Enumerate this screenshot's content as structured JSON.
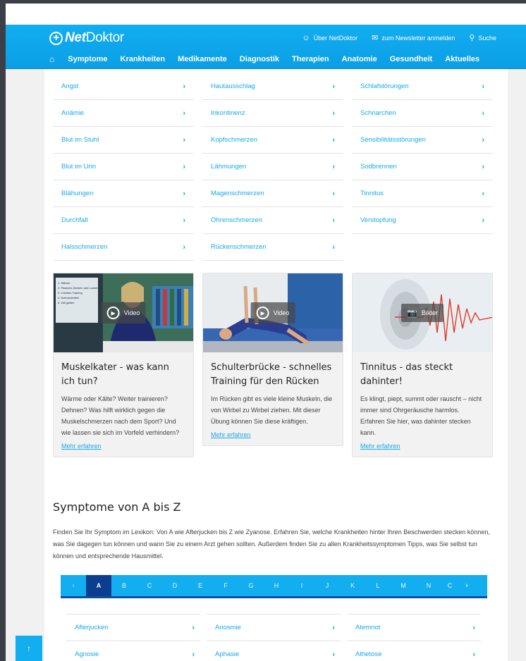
{
  "header": {
    "logo_net": "Net",
    "logo_doktor": "Doktor",
    "top_links": [
      {
        "icon": "person-icon",
        "label": "Über NetDoktor"
      },
      {
        "icon": "mail-icon",
        "label": "zum Newsletter anmelden"
      },
      {
        "icon": "search-icon",
        "label": "Suche"
      }
    ],
    "nav": [
      "Symptome",
      "Krankheiten",
      "Medikamente",
      "Diagnostik",
      "Therapien",
      "Anatomie",
      "Gesundheit",
      "Aktuelles"
    ]
  },
  "symptoms": {
    "col1": [
      "Angst",
      "Anämie",
      "Blut im Stuhl",
      "Blut im Urin",
      "Blähungen",
      "Durchfall",
      "Halsschmerzen"
    ],
    "col2": [
      "Hautausschlag",
      "Inkontinenz",
      "Kopfschmerzen",
      "Lähmungen",
      "Magenschmerzen",
      "Ohrenschmerzen",
      "Rückenschmerzen"
    ],
    "col3": [
      "Schlafstörungen",
      "Schnarchen",
      "Sensibilitätsstörungen",
      "Sodbrennen",
      "Tinnitus",
      "Verstopfung"
    ]
  },
  "cards": [
    {
      "badge": "Video",
      "title": "Muskelkater - was kann ich tun?",
      "text": "Wärme oder Kälte? Weiter trainieren? Dehnen? Was hilft wirklich gegen die Muskelschmerzen nach dem Sport? Und wie lassen sie sich im Vorfeld verhindern?",
      "more": "Mehr erfahren",
      "slide_list": [
        "1. Wärme",
        "2. Passives Dehnen und Lockern",
        "3. Leichtes Training",
        "4. Schmerzmittel",
        "5. Zeit geben"
      ]
    },
    {
      "badge": "Video",
      "title": "Schulterbrücke - schnelles Training für den Rücken",
      "text": "Im Rücken gibt es viele kleine Muskeln, die von Wirbel zu Wirbel ziehen. Mit dieser Übung können Sie diese kräftigen.",
      "more": "Mehr erfahren"
    },
    {
      "badge": "Bilder",
      "title": "Tinnitus - das steckt dahinter!",
      "text": "Es klingt, piept, summt oder rauscht – nicht immer sind Ohrgeräusche harmlos. Erfahren Sie hier, was dahinter stecken kann.",
      "more": "Mehr erfahren"
    }
  ],
  "az": {
    "title": "Symptome von A bis Z",
    "intro": "Finden Sie Ihr Symptom im Lexikon: Von A wie Afterjucken bis Z wie Zyanose. Erfahren Sie, welche Krankheiten hinter Ihren Beschwerden stecken können, was Sie dagegen tun können und wann Sie zu einem Arzt gehen sollten. Außerdem finden Sie zu allen Krankheitssymptomen Tipps, was Sie selbst tun können und entsprechende Hausmittel.",
    "letters": [
      "A",
      "B",
      "C",
      "D",
      "E",
      "F",
      "G",
      "H",
      "I",
      "J",
      "K",
      "L",
      "M",
      "N",
      "C"
    ],
    "active": "A",
    "prev": "‹",
    "next": "›",
    "col1": [
      "Afterjucken",
      "Agnosie"
    ],
    "col2": [
      "Anosmie",
      "Aphasie"
    ],
    "col3": [
      "Atemnot",
      "Athetose"
    ]
  },
  "to_top": "↑"
}
